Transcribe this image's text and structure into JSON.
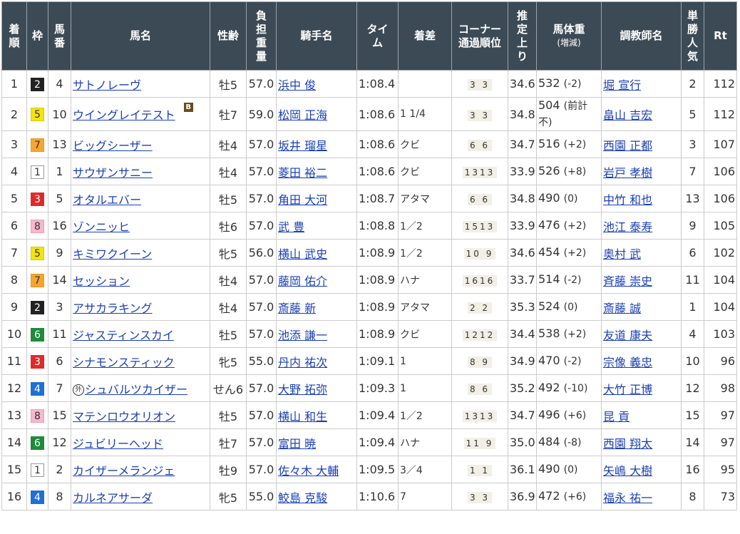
{
  "headers": {
    "rank": "着順",
    "waku": "枠",
    "number": "馬番",
    "horse": "馬名",
    "sex_age": "性齢",
    "weight_carried": "負担重量",
    "jockey": "騎手名",
    "time": "タイム",
    "margin": "着差",
    "corner": "コーナー通過順位",
    "last3f": "推定上り",
    "horse_weight": "馬体重",
    "horse_weight_sub": "(増減)",
    "trainer": "調教師名",
    "popularity": "単勝人気",
    "rt": "Rt"
  },
  "header_lines": {
    "rank": [
      "着",
      "順"
    ],
    "number": [
      "馬",
      "番"
    ],
    "weight_carried": [
      "負",
      "担",
      "重",
      "量"
    ],
    "time": [
      "タイ",
      "ム"
    ],
    "corner": [
      "コーナー",
      "通過順位"
    ],
    "last3f": [
      "推",
      "定",
      "上",
      "り"
    ],
    "popularity": [
      "単",
      "勝",
      "人",
      "気"
    ]
  },
  "rows": [
    {
      "rank": "1",
      "waku": "2",
      "num": "4",
      "horse": "サトノレーヴ",
      "sex_age": "牡5",
      "wt": "57.0",
      "jockey": "浜中 俊",
      "time": "1:08.4",
      "margin": "",
      "corner": "3 3",
      "last3f": "34.6",
      "hw": "532",
      "hwd": "(-2)",
      "trainer": "堀 宣行",
      "pop": "2",
      "rt": "112"
    },
    {
      "rank": "2",
      "waku": "5",
      "num": "10",
      "horse": "ウイングレイテスト",
      "blinker": "B",
      "sex_age": "牡7",
      "wt": "59.0",
      "jockey": "松岡 正海",
      "time": "1:08.6",
      "margin": "1 1/4",
      "corner": "3 3",
      "last3f": "34.8",
      "hw": "504",
      "hwd": "(前計不)",
      "trainer": "畠山 吉宏",
      "pop": "5",
      "rt": "112"
    },
    {
      "rank": "3",
      "waku": "7",
      "num": "13",
      "horse": "ビッグシーザー",
      "sex_age": "牡4",
      "wt": "57.0",
      "jockey": "坂井 瑠星",
      "time": "1:08.6",
      "margin": "クビ",
      "corner": "6 6",
      "last3f": "34.7",
      "hw": "516",
      "hwd": "(+2)",
      "trainer": "西園 正都",
      "pop": "3",
      "rt": "107"
    },
    {
      "rank": "4",
      "waku": "1",
      "num": "1",
      "horse": "サウザンサニー",
      "sex_age": "牡4",
      "wt": "57.0",
      "jockey": "菱田 裕二",
      "time": "1:08.6",
      "margin": "クビ",
      "corner": "1313",
      "last3f": "33.9",
      "hw": "526",
      "hwd": "(+8)",
      "trainer": "岩戸 孝樹",
      "pop": "7",
      "rt": "106"
    },
    {
      "rank": "5",
      "waku": "3",
      "num": "5",
      "horse": "オタルエバー",
      "sex_age": "牡5",
      "wt": "57.0",
      "jockey": "角田 大河",
      "time": "1:08.7",
      "margin": "アタマ",
      "corner": "6 6",
      "last3f": "34.8",
      "hw": "490",
      "hwd": "(0)",
      "trainer": "中竹 和也",
      "pop": "13",
      "rt": "106"
    },
    {
      "rank": "6",
      "waku": "8",
      "num": "16",
      "horse": "ゾンニッヒ",
      "sex_age": "牡6",
      "wt": "57.0",
      "jockey": "武 豊",
      "time": "1:08.8",
      "margin": "1／2",
      "corner": "1513",
      "last3f": "33.9",
      "hw": "476",
      "hwd": "(+2)",
      "trainer": "池江 泰寿",
      "pop": "9",
      "rt": "105"
    },
    {
      "rank": "7",
      "waku": "5",
      "num": "9",
      "horse": "キミワクイーン",
      "sex_age": "牝5",
      "wt": "56.0",
      "jockey": "横山 武史",
      "time": "1:08.9",
      "margin": "1／2",
      "corner": "10 9",
      "last3f": "34.6",
      "hw": "454",
      "hwd": "(+2)",
      "trainer": "奥村 武",
      "pop": "6",
      "rt": "102"
    },
    {
      "rank": "8",
      "waku": "7",
      "num": "14",
      "horse": "セッション",
      "sex_age": "牡4",
      "wt": "57.0",
      "jockey": "藤岡 佑介",
      "time": "1:08.9",
      "margin": "ハナ",
      "corner": "1616",
      "last3f": "33.7",
      "hw": "514",
      "hwd": "(-2)",
      "trainer": "斉藤 崇史",
      "pop": "11",
      "rt": "104"
    },
    {
      "rank": "9",
      "waku": "2",
      "num": "3",
      "horse": "アサカラキング",
      "sex_age": "牡4",
      "wt": "57.0",
      "jockey": "斎藤 新",
      "time": "1:08.9",
      "margin": "アタマ",
      "corner": "2 2",
      "last3f": "35.3",
      "hw": "524",
      "hwd": "(0)",
      "trainer": "斎藤 誠",
      "pop": "1",
      "rt": "104"
    },
    {
      "rank": "10",
      "waku": "6",
      "num": "11",
      "horse": "ジャスティンスカイ",
      "sex_age": "牡5",
      "wt": "57.0",
      "jockey": "池添 謙一",
      "time": "1:08.9",
      "margin": "クビ",
      "corner": "1212",
      "last3f": "34.4",
      "hw": "538",
      "hwd": "(+2)",
      "trainer": "友道 康夫",
      "pop": "4",
      "rt": "103"
    },
    {
      "rank": "11",
      "waku": "3",
      "num": "6",
      "horse": "シナモンスティック",
      "sex_age": "牝5",
      "wt": "55.0",
      "jockey": "丹内 祐次",
      "time": "1:09.1",
      "margin": "1",
      "corner": "8 9",
      "last3f": "34.9",
      "hw": "470",
      "hwd": "(-2)",
      "trainer": "宗像 義忠",
      "pop": "10",
      "rt": "96"
    },
    {
      "rank": "12",
      "waku": "4",
      "num": "7",
      "horse": "シュバルツカイザー",
      "foreign": "外",
      "sex_age": "せん6",
      "wt": "57.0",
      "jockey": "大野 拓弥",
      "time": "1:09.3",
      "margin": "1",
      "corner": "8 6",
      "last3f": "35.2",
      "hw": "492",
      "hwd": "(-10)",
      "trainer": "大竹 正博",
      "pop": "12",
      "rt": "98"
    },
    {
      "rank": "13",
      "waku": "8",
      "num": "15",
      "horse": "マテンロウオリオン",
      "sex_age": "牡5",
      "wt": "57.0",
      "jockey": "横山 和生",
      "time": "1:09.4",
      "margin": "1／2",
      "corner": "1313",
      "last3f": "34.7",
      "hw": "496",
      "hwd": "(+6)",
      "trainer": "昆 貢",
      "pop": "15",
      "rt": "97"
    },
    {
      "rank": "14",
      "waku": "6",
      "num": "12",
      "horse": "ジュビリーヘッド",
      "sex_age": "牡7",
      "wt": "57.0",
      "jockey": "富田 暁",
      "time": "1:09.4",
      "margin": "ハナ",
      "corner": "11 9",
      "last3f": "35.0",
      "hw": "484",
      "hwd": "(-8)",
      "trainer": "西園 翔太",
      "pop": "14",
      "rt": "97"
    },
    {
      "rank": "15",
      "waku": "1",
      "num": "2",
      "horse": "カイザーメランジェ",
      "sex_age": "牡9",
      "wt": "57.0",
      "jockey": "佐々木 大輔",
      "time": "1:09.5",
      "margin": "3／4",
      "corner": "1 1",
      "last3f": "36.1",
      "hw": "490",
      "hwd": "(0)",
      "trainer": "矢嶋 大樹",
      "pop": "16",
      "rt": "95"
    },
    {
      "rank": "16",
      "waku": "4",
      "num": "8",
      "horse": "カルネアサーダ",
      "sex_age": "牝5",
      "wt": "55.0",
      "jockey": "鮫島 克駿",
      "time": "1:10.6",
      "margin": "7",
      "corner": "3 3",
      "last3f": "36.9",
      "hw": "472",
      "hwd": "(+6)",
      "trainer": "福永 祐一",
      "pop": "8",
      "rt": "73"
    }
  ]
}
